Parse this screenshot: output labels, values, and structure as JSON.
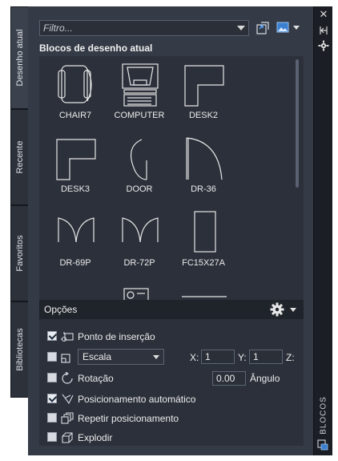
{
  "window": {
    "close_glyph": "✕",
    "vertical_title": "BLOCOS"
  },
  "tabs": [
    {
      "label": "Desenho atual",
      "active": true
    },
    {
      "label": "Recente",
      "active": false
    },
    {
      "label": "Favoritos",
      "active": false
    },
    {
      "label": "Bibliotecas",
      "active": false
    }
  ],
  "toolbar": {
    "filter_placeholder": "Filtro...",
    "icons": [
      "import-block-icon",
      "view-mode-icon"
    ]
  },
  "blocks_section": {
    "title": "Blocos de desenho atual",
    "items": [
      {
        "label": "CHAIR7",
        "icon": "chair-icon"
      },
      {
        "label": "COMPUTER",
        "icon": "computer-icon"
      },
      {
        "label": "DESK2",
        "icon": "desk2-icon"
      },
      {
        "label": "DESK3",
        "icon": "desk3-icon"
      },
      {
        "label": "DOOR",
        "icon": "door-icon"
      },
      {
        "label": "DR-36",
        "icon": "dr36-icon"
      },
      {
        "label": "DR-69P",
        "icon": "dr69p-icon"
      },
      {
        "label": "DR-72P",
        "icon": "dr72p-icon"
      },
      {
        "label": "FC15X27A",
        "icon": "fc15x27a-icon"
      }
    ]
  },
  "options": {
    "title": "Opções",
    "insertion_point": {
      "label": "Ponto de inserção",
      "checked": true
    },
    "scale": {
      "selected": "Escala",
      "checked": false
    },
    "x_label": "X:",
    "x_value": "1",
    "y_label": "Y:",
    "y_value": "1",
    "z_label": "Z:",
    "rotation": {
      "label": "Rotação",
      "checked": false
    },
    "angle_value": "0.00",
    "angle_label": "Ângulo",
    "auto_placement": {
      "label": "Posicionamento automático",
      "checked": true
    },
    "repeat_placement": {
      "label": "Repetir posicionamento",
      "checked": false
    },
    "explode": {
      "label": "Explodir",
      "checked": false
    }
  },
  "colors": {
    "panel_bg": "#353b46",
    "inner_bg": "#2b303a",
    "text": "#ececec"
  }
}
